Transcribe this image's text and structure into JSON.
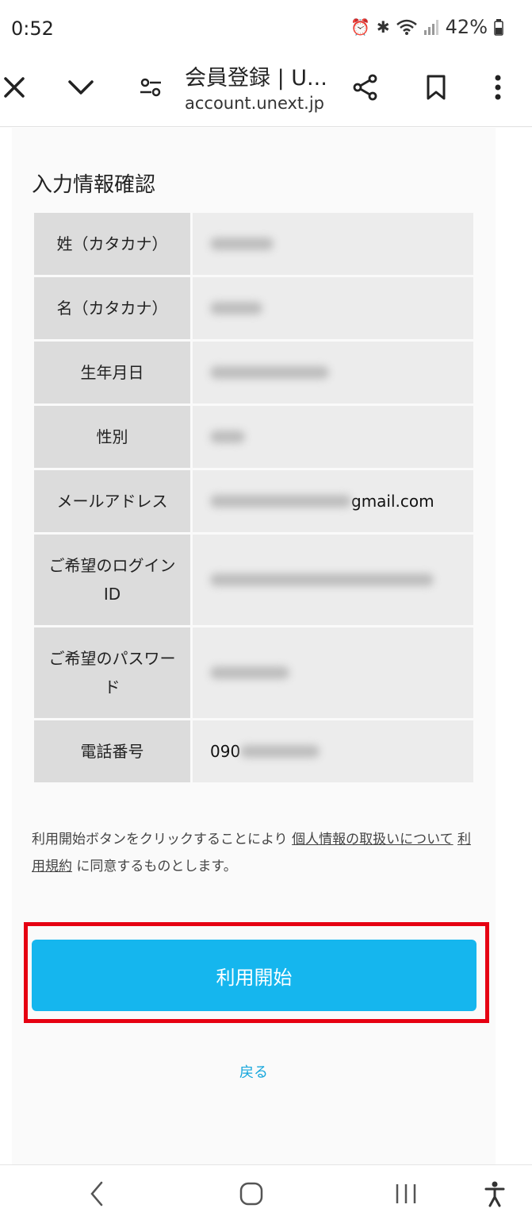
{
  "status": {
    "time": "0:52",
    "battery": "42%"
  },
  "browser": {
    "title": "会員登録 | U...",
    "url": "account.unext.jp"
  },
  "section_title": "入力情報確認",
  "rows": [
    {
      "label": "姓（カタカナ）",
      "value": "",
      "blur_width": 80
    },
    {
      "label": "名（カタカナ）",
      "value": "",
      "blur_width": 66
    },
    {
      "label": "生年月日",
      "value": "",
      "blur_width": 150
    },
    {
      "label": "性別",
      "value": "",
      "blur_width": 44
    },
    {
      "label": "メールアドレス",
      "value": "gmail.com",
      "blur_width": 178
    },
    {
      "label": "ご希望のログインID",
      "value": "",
      "blur_width": 282
    },
    {
      "label": "ご希望のパスワード",
      "value": "",
      "blur_width": 100
    },
    {
      "label": "電話番号",
      "value": "090",
      "blur_width": 100
    }
  ],
  "agree": {
    "prefix": "利用開始ボタンをクリックすることにより ",
    "link1": "個人情報の取扱いについて",
    "link2": "利用規約",
    "suffix": " に同意するものとします。"
  },
  "start_button": "利用開始",
  "back_link": "戻る",
  "icons": {
    "close": "close-icon",
    "collapse": "chevron-down-icon",
    "tabs": "tab-settings-icon",
    "share": "share-icon",
    "bookmark": "bookmark-icon",
    "menu": "more-vert-icon"
  }
}
